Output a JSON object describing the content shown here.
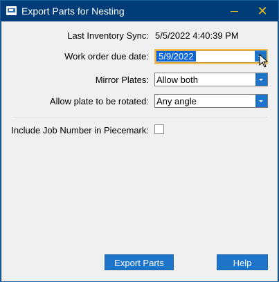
{
  "window": {
    "title": "Export Parts for Nesting"
  },
  "form": {
    "last_sync_label": "Last Inventory Sync:",
    "last_sync_value": "5/5/2022 4:40:39 PM",
    "due_date_label": "Work order due date:",
    "due_date_value": "5/9/2022",
    "mirror_label": "Mirror Plates:",
    "mirror_value": "Allow both",
    "rotate_label": "Allow plate to be rotated:",
    "rotate_value": "Any angle",
    "include_job_label": "Include Job Number in Piecemark:",
    "include_job_checked": false
  },
  "buttons": {
    "export_label": "Export Parts",
    "help_label": "Help"
  },
  "colors": {
    "titlebar": "#003c78",
    "accent": "#1e74c9",
    "window_controls": "#e8c020"
  }
}
